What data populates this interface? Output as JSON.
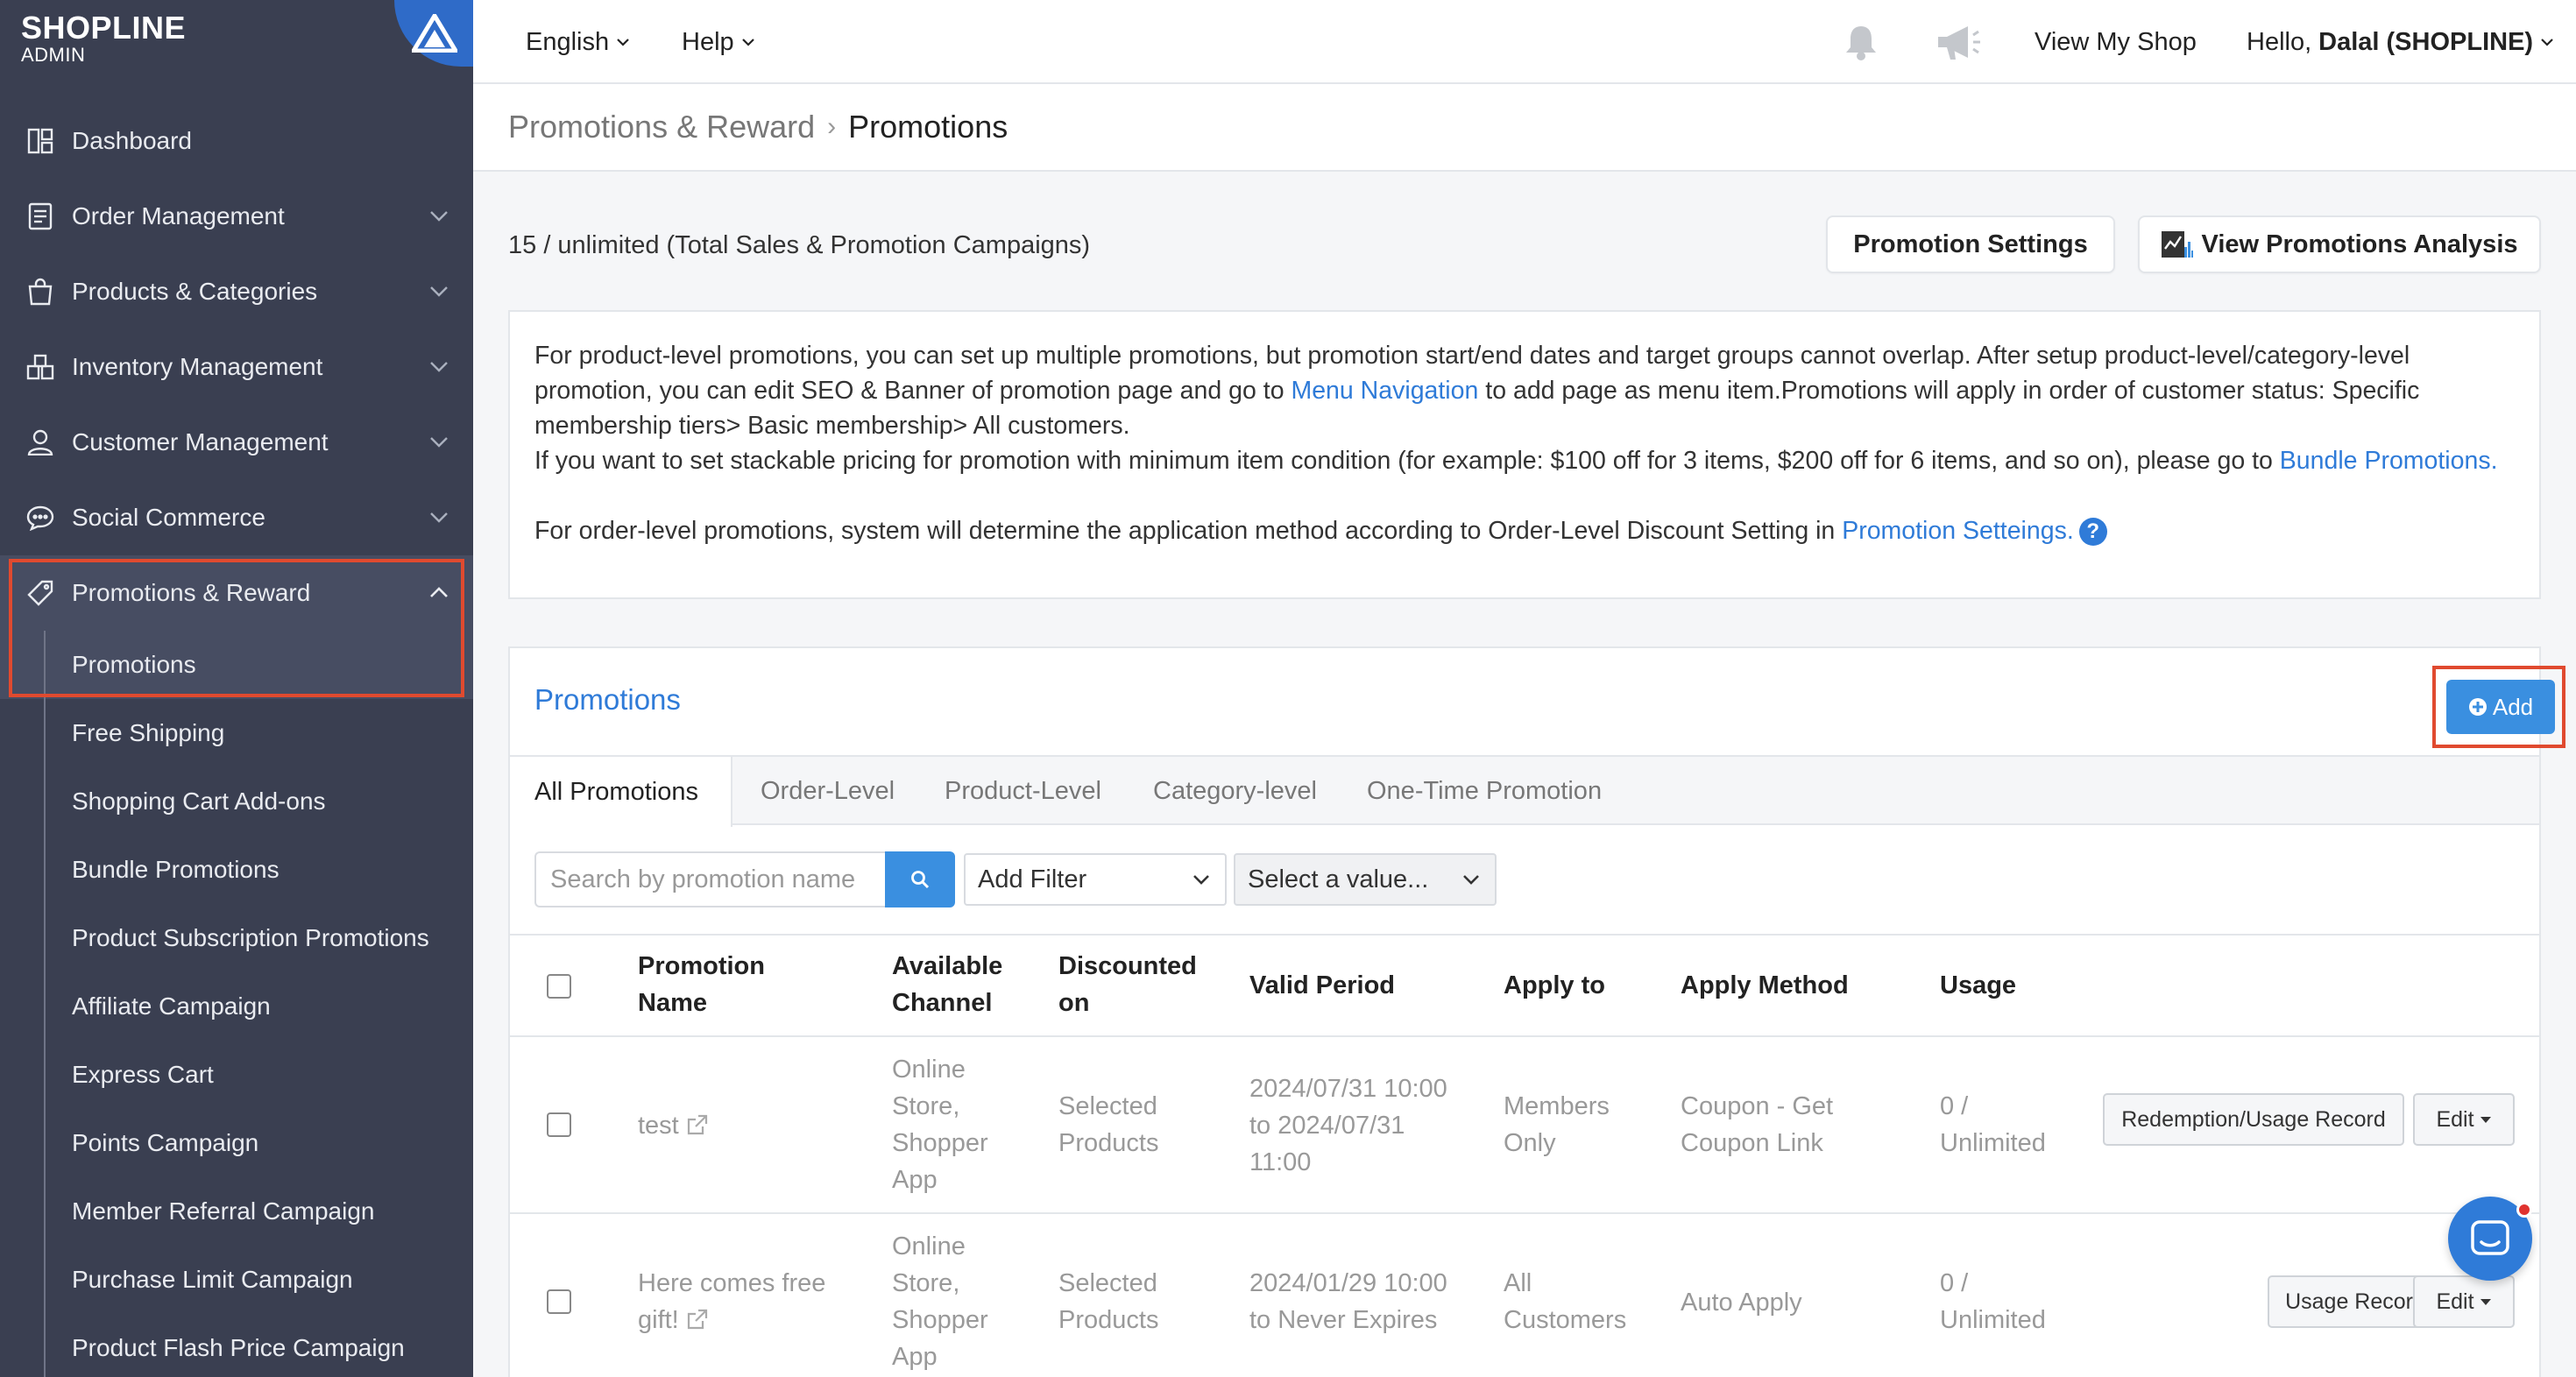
{
  "brand": {
    "logo": "SHOPLINE",
    "subtitle": "ADMIN"
  },
  "sidebar": {
    "items": [
      {
        "label": "Dashboard",
        "icon": "dashboard-icon"
      },
      {
        "label": "Order Management",
        "icon": "order-icon"
      },
      {
        "label": "Products & Categories",
        "icon": "bag-icon"
      },
      {
        "label": "Inventory Management",
        "icon": "inventory-icon"
      },
      {
        "label": "Customer Management",
        "icon": "user-icon"
      },
      {
        "label": "Social Commerce",
        "icon": "chat-bubble-icon"
      },
      {
        "label": "Promotions & Reward",
        "icon": "tag-icon",
        "expanded": true
      }
    ],
    "sub_items": [
      "Promotions",
      "Free Shipping",
      "Shopping Cart Add-ons",
      "Bundle Promotions",
      "Product Subscription Promotions",
      "Affiliate Campaign",
      "Express Cart",
      "Points Campaign",
      "Member Referral Campaign",
      "Purchase Limit Campaign",
      "Product Flash Price Campaign"
    ]
  },
  "topbar": {
    "language": "English",
    "help": "Help",
    "view_shop": "View My Shop",
    "greeting_prefix": "Hello,",
    "user": "Dalal (SHOPLINE)"
  },
  "breadcrumb": {
    "parent": "Promotions & Reward",
    "current": "Promotions"
  },
  "quota": "15 / unlimited (Total Sales & Promotion Campaigns)",
  "buttons": {
    "settings": "Promotion Settings",
    "analysis": "View Promotions Analysis"
  },
  "info": {
    "p1_a": "For product-level promotions, you can set up multiple promotions, but promotion start/end dates and target groups cannot overlap. After setup product-level/category-level promotion, you can edit SEO & Banner of promotion page and go to ",
    "p1_link": "Menu Navigation",
    "p1_b": " to add page as menu item.Promotions will apply in order of customer status: Specific membership tiers> Basic membership> All customers.",
    "p2_a": "If you want to set stackable pricing for promotion with minimum item condition (for example: $100 off for 3 items, $200 off for 6 items, and so on), please go to ",
    "p2_link": "Bundle Promotions.",
    "p3_a": "For order-level promotions, system will determine the application method according to Order-Level Discount Setting in ",
    "p3_link": "Promotion Setteings.",
    "help_glyph": "?"
  },
  "panel": {
    "title": "Promotions",
    "add_label": "Add",
    "tabs": [
      "All Promotions",
      "Order-Level",
      "Product-Level",
      "Category-level",
      "One-Time Promotion"
    ],
    "search_placeholder": "Search by promotion name",
    "filter_label": "Add Filter",
    "value_label": "Select a value..."
  },
  "table": {
    "headers": {
      "name": [
        "Promotion",
        "Name"
      ],
      "channel": [
        "Available",
        "Channel"
      ],
      "discounted": [
        "Discounted",
        "on"
      ],
      "period": "Valid Period",
      "apply_to": "Apply to",
      "method": "Apply Method",
      "usage": "Usage"
    },
    "rows": [
      {
        "name": [
          "test"
        ],
        "channel": [
          "Online",
          "Store,",
          "Shopper",
          "App"
        ],
        "discounted": [
          "Selected",
          "Products"
        ],
        "period": [
          "2024/07/31 10:00",
          "to 2024/07/31",
          "11:00"
        ],
        "apply_to": [
          "Members",
          "Only"
        ],
        "method": [
          "Coupon - Get",
          "Coupon Link"
        ],
        "usage": [
          "0 /",
          "Unlimited"
        ],
        "record_btn": "Redemption/Usage Record",
        "edit_btn": "Edit"
      },
      {
        "name": [
          "Here comes free",
          "gift!"
        ],
        "channel": [
          "Online",
          "Store,",
          "Shopper",
          "App"
        ],
        "discounted": [
          "Selected",
          "Products"
        ],
        "period": [
          "2024/01/29 10:00",
          "to Never Expires"
        ],
        "apply_to": [
          "All",
          "Customers"
        ],
        "method": [
          "Auto Apply"
        ],
        "usage": [
          "0 /",
          "Unlimited"
        ],
        "record_btn": "Usage Record",
        "edit_btn": "Edit"
      }
    ]
  },
  "colors": {
    "sidebar": "#3a3f51",
    "accent": "#2f7bd8",
    "highlight": "#e04a2f"
  }
}
